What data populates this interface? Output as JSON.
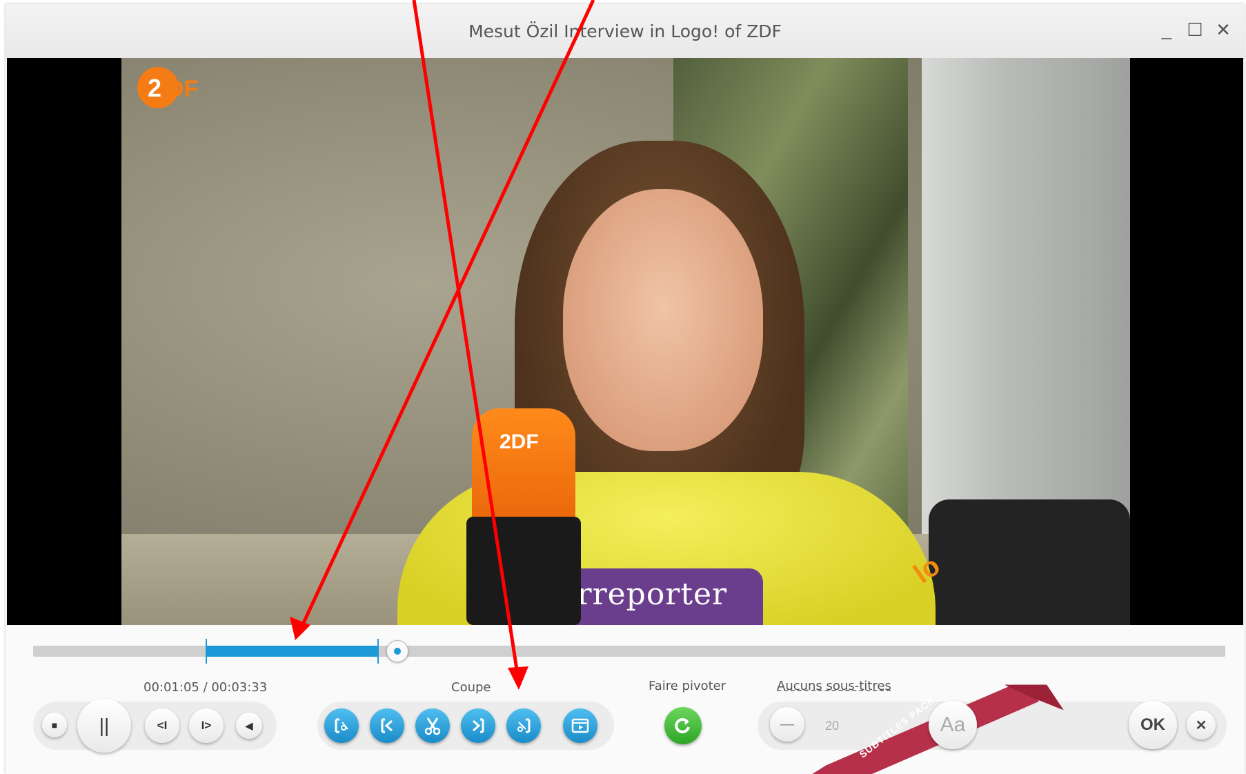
{
  "window": {
    "title": "Mesut Özil Interview in Logo! of ZDF",
    "controls": {
      "minimize": "_",
      "maximize": "☐",
      "close": "✕"
    }
  },
  "video": {
    "channel_logo": "2DF",
    "mic_logo": "2DF",
    "shirt_text": "nderreporter",
    "badge": "lo"
  },
  "player": {
    "time": "00:01:05 / 00:03:33",
    "progress_fraction": 0.305,
    "selection": {
      "start": "",
      "end": ""
    },
    "buttons": {
      "stop": "■",
      "pause": "||",
      "prev_frame": "<I",
      "next_frame": "I>",
      "volume": "◀"
    }
  },
  "cut": {
    "label": "Coupe",
    "buttons": [
      "cut-start-icon",
      "set-start-icon",
      "scissors-icon",
      "set-end-icon",
      "cut-end-icon"
    ]
  },
  "rotate": {
    "label": "Faire pivoter"
  },
  "subtitles": {
    "label": "Aucuns sous-titres",
    "minus": "—",
    "size": "20",
    "font_button": "Aa",
    "ribbon": "SUBTITLES PACK"
  },
  "actions": {
    "ok": "OK",
    "close": "✕"
  },
  "colors": {
    "accent": "#1c9ad8",
    "annotation": "#ff0000",
    "green": "#2da526",
    "ribbon": "#b53048"
  }
}
